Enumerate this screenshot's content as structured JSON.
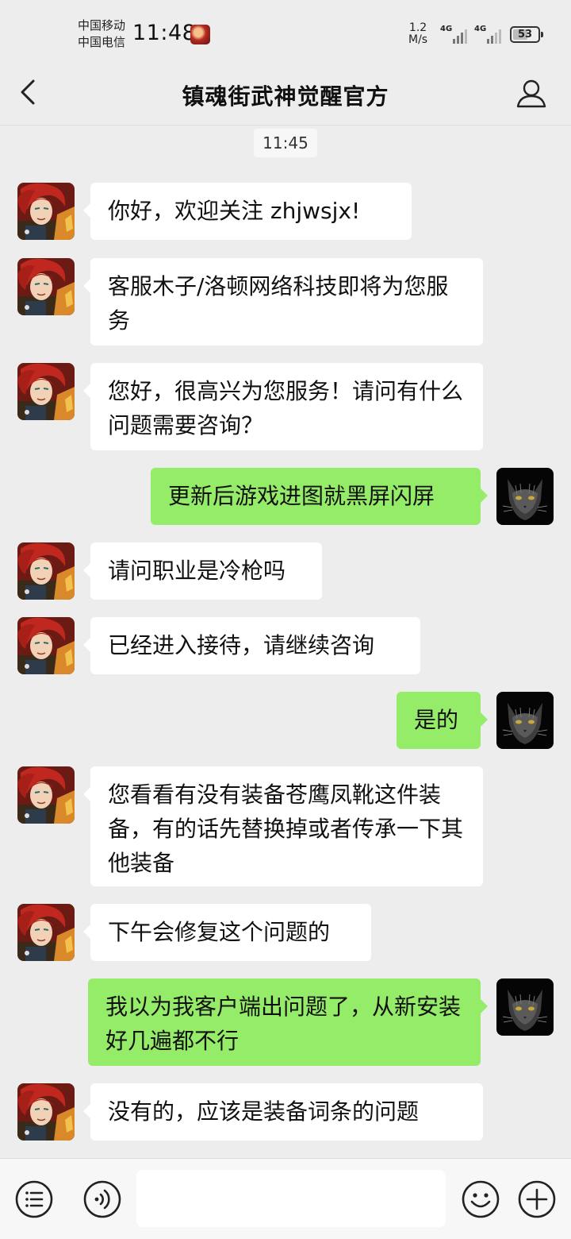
{
  "status_bar": {
    "carrier_1": "中国移动",
    "carrier_2": "中国电信",
    "time": "11:48",
    "net_speed_value": "1.2",
    "net_speed_unit": "M/s",
    "signal_1_label": "4G",
    "signal_2_label": "4G",
    "battery": "53"
  },
  "header": {
    "title": "镇魂街武神觉醒官方"
  },
  "chat": {
    "timestamp": "11:45",
    "messages": [
      {
        "sender": "official",
        "text": "你好，欢迎关注 zhjwsjx!"
      },
      {
        "sender": "official",
        "text": "客服木子/洛顿网络科技即将为您服务"
      },
      {
        "sender": "official",
        "text": "您好，很高兴为您服务！请问有什么问题需要咨询？"
      },
      {
        "sender": "me",
        "text": "更新后游戏进图就黑屏闪屏"
      },
      {
        "sender": "official",
        "text": "请问职业是冷枪吗"
      },
      {
        "sender": "official",
        "text": "已经进入接待，请继续咨询"
      },
      {
        "sender": "me",
        "text": "是的"
      },
      {
        "sender": "official",
        "text": "您看看有没有装备苍鹰凤靴这件装备，有的话先替换掉或者传承一下其他装备"
      },
      {
        "sender": "official",
        "text": "下午会修复这个问题的"
      },
      {
        "sender": "me",
        "text": "我以为我客户端出问题了，从新安装好几遍都不行"
      },
      {
        "sender": "official",
        "text": "没有的，应该是装备词条的问题"
      }
    ]
  },
  "input_bar": {
    "left_icons": [
      "menu-icon",
      "voice-icon"
    ],
    "right_icons": [
      "emoji-icon",
      "plus-icon"
    ]
  },
  "colors": {
    "background": "#ededed",
    "incoming_bubble": "#ffffff",
    "outgoing_bubble": "#95ec69"
  }
}
